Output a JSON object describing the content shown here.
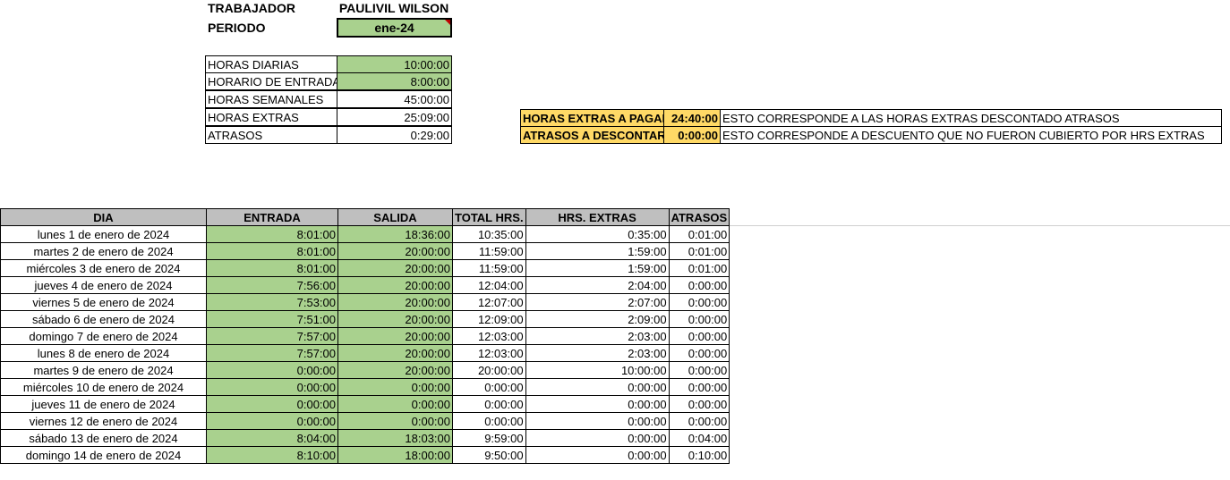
{
  "header": {
    "trabajador_label": "TRABAJADOR",
    "trabajador_value": "PAULIVIL WILSON",
    "periodo_label": "PERIODO",
    "periodo_value": "ene-24"
  },
  "params": [
    {
      "label": "HORAS DIARIAS",
      "value": "10:00:00"
    },
    {
      "label": "HORARIO DE ENTRADA",
      "value": "8:00:00"
    },
    {
      "label": "HORAS SEMANALES",
      "value": "45:00:00"
    },
    {
      "label": "HORAS EXTRAS",
      "value": "25:09:00"
    },
    {
      "label": "ATRASOS",
      "value": "0:29:00"
    }
  ],
  "summary": [
    {
      "label": "HORAS EXTRAS A PAGAR",
      "value": "24:40:00",
      "note": "ESTO CORRESPONDE A LAS HORAS EXTRAS DESCONTADO ATRASOS"
    },
    {
      "label": "ATRASOS A DESCONTAR",
      "value": "0:00:00",
      "note": "ESTO CORRESPONDE A DESCUENTO QUE NO FUERON CUBIERTO POR HRS EXTRAS"
    }
  ],
  "table": {
    "headers": [
      "DIA",
      "ENTRADA",
      "SALIDA",
      "TOTAL HRS.",
      "HRS. EXTRAS",
      "ATRASOS"
    ],
    "rows": [
      [
        "lunes 1 de enero de 2024",
        "8:01:00",
        "18:36:00",
        "10:35:00",
        "0:35:00",
        "0:01:00"
      ],
      [
        "martes 2 de enero de 2024",
        "8:01:00",
        "20:00:00",
        "11:59:00",
        "1:59:00",
        "0:01:00"
      ],
      [
        "miércoles 3 de enero de 2024",
        "8:01:00",
        "20:00:00",
        "11:59:00",
        "1:59:00",
        "0:01:00"
      ],
      [
        "jueves 4 de enero de 2024",
        "7:56:00",
        "20:00:00",
        "12:04:00",
        "2:04:00",
        "0:00:00"
      ],
      [
        "viernes 5 de enero de 2024",
        "7:53:00",
        "20:00:00",
        "12:07:00",
        "2:07:00",
        "0:00:00"
      ],
      [
        "sábado 6 de enero de 2024",
        "7:51:00",
        "20:00:00",
        "12:09:00",
        "2:09:00",
        "0:00:00"
      ],
      [
        "domingo 7 de enero de 2024",
        "7:57:00",
        "20:00:00",
        "12:03:00",
        "2:03:00",
        "0:00:00"
      ],
      [
        "lunes 8 de enero de 2024",
        "7:57:00",
        "20:00:00",
        "12:03:00",
        "2:03:00",
        "0:00:00"
      ],
      [
        "martes 9 de enero de 2024",
        "0:00:00",
        "20:00:00",
        "20:00:00",
        "10:00:00",
        "0:00:00"
      ],
      [
        "miércoles 10 de enero de 2024",
        "0:00:00",
        "0:00:00",
        "0:00:00",
        "0:00:00",
        "0:00:00"
      ],
      [
        "jueves 11 de enero de 2024",
        "0:00:00",
        "0:00:00",
        "0:00:00",
        "0:00:00",
        "0:00:00"
      ],
      [
        "viernes 12 de enero de 2024",
        "0:00:00",
        "0:00:00",
        "0:00:00",
        "0:00:00",
        "0:00:00"
      ],
      [
        "sábado 13 de enero de 2024",
        "8:04:00",
        "18:03:00",
        "9:59:00",
        "0:00:00",
        "0:04:00"
      ],
      [
        "domingo 14 de enero de 2024",
        "8:10:00",
        "18:00:00",
        "9:50:00",
        "0:00:00",
        "0:10:00"
      ]
    ]
  }
}
